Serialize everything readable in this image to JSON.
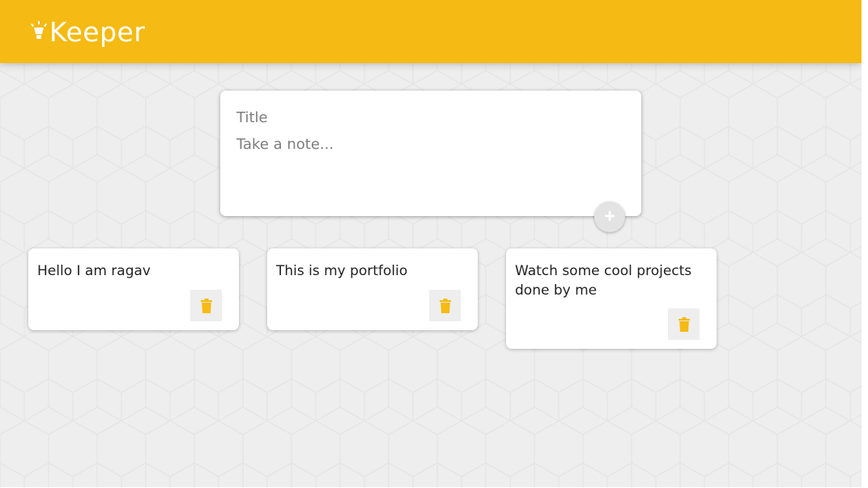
{
  "app": {
    "title": "Keeper",
    "icon": "lightbulb-icon",
    "accent_color": "#f5ba13",
    "background_color": "#eeeeee"
  },
  "composer": {
    "title_placeholder": "Title",
    "content_placeholder": "Take a note...",
    "add_button_label": "+",
    "add_button_icon": "plus-icon"
  },
  "notes": [
    {
      "text": "Hello I am ragav",
      "delete_icon": "trash-icon"
    },
    {
      "text": "This is my portfolio",
      "delete_icon": "trash-icon"
    },
    {
      "text": "Watch some cool projects done by me",
      "delete_icon": "trash-icon"
    }
  ]
}
